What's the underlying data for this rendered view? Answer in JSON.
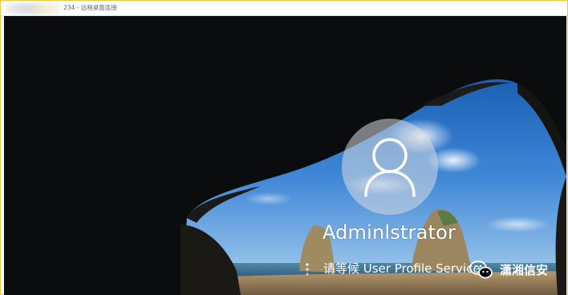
{
  "window": {
    "title": "234 - 远程桌面连接"
  },
  "lock_screen": {
    "user_icon": "user-icon",
    "username": "Adminlstrator",
    "status_message": "请等候 User Profile Service",
    "spinner_icon": "loading-spinner-icon"
  },
  "watermark": {
    "icon": "wechat-icon",
    "text": "潇湘信安"
  },
  "colors": {
    "window_border": "#e8c84a",
    "text": "#ffffff",
    "sky": "#2e72c7"
  }
}
